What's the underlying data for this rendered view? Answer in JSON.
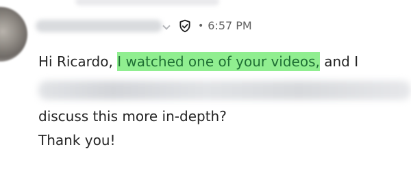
{
  "message": {
    "time": "6:57 PM",
    "separator": "•",
    "line1_prefix": "Hi Ricardo, ",
    "line1_highlight": "I watched one of your videos,",
    "line1_suffix": " and I",
    "line3": "discuss this more in-depth?",
    "line4": "Thank you!",
    "highlight_color": "#90ee90",
    "highlight_text_color": "#1f6f34",
    "text_color": "#242424",
    "meta_color": "#616161"
  },
  "icons": {
    "verified": "shield-check-icon",
    "menu": "chevron-down-icon"
  }
}
